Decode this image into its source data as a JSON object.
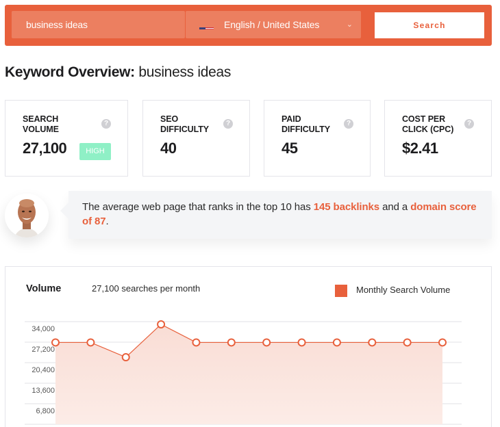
{
  "search": {
    "keyword_value": "business ideas",
    "language_label": "English / United States",
    "language_flag": "us-flag-icon",
    "search_button": "Search"
  },
  "title": {
    "prefix": "Keyword Overview:",
    "keyword": "business ideas"
  },
  "metrics": [
    {
      "label": "Search Volume",
      "value": "27,100",
      "badge": "HIGH",
      "help": "?"
    },
    {
      "label": "SEO Difficulty",
      "value": "40",
      "help": "?"
    },
    {
      "label": "Paid Difficulty",
      "value": "45",
      "help": "?"
    },
    {
      "label": "Cost Per Click (CPC)",
      "value": "$2.41",
      "help": "?"
    }
  ],
  "tip": {
    "text_before": "The average web page that ranks in the top 10 has ",
    "highlight1": "145 backlinks",
    "text_middle": " and a ",
    "highlight2": "domain score of 87",
    "text_after": "."
  },
  "volume_panel": {
    "title": "Volume",
    "subtitle": "27,100 searches per month",
    "legend": "Monthly Search Volume"
  },
  "colors": {
    "accent": "#e8603c",
    "badge_high": "#8ff0c6",
    "area_fill": "#fbe3dc"
  },
  "chart_data": {
    "type": "area",
    "title": "Volume",
    "legend": [
      "Monthly Search Volume"
    ],
    "legend_position": "top-right",
    "y_ticks": [
      "34,000",
      "27,200",
      "20,400",
      "13,600",
      "6,800"
    ],
    "ylim": [
      0,
      34000
    ],
    "grid": true,
    "series": [
      {
        "name": "Monthly Search Volume",
        "values": [
          27100,
          27100,
          22200,
          33100,
          27100,
          27100,
          27100,
          27100,
          27100,
          27100,
          27100,
          27100
        ]
      }
    ]
  }
}
